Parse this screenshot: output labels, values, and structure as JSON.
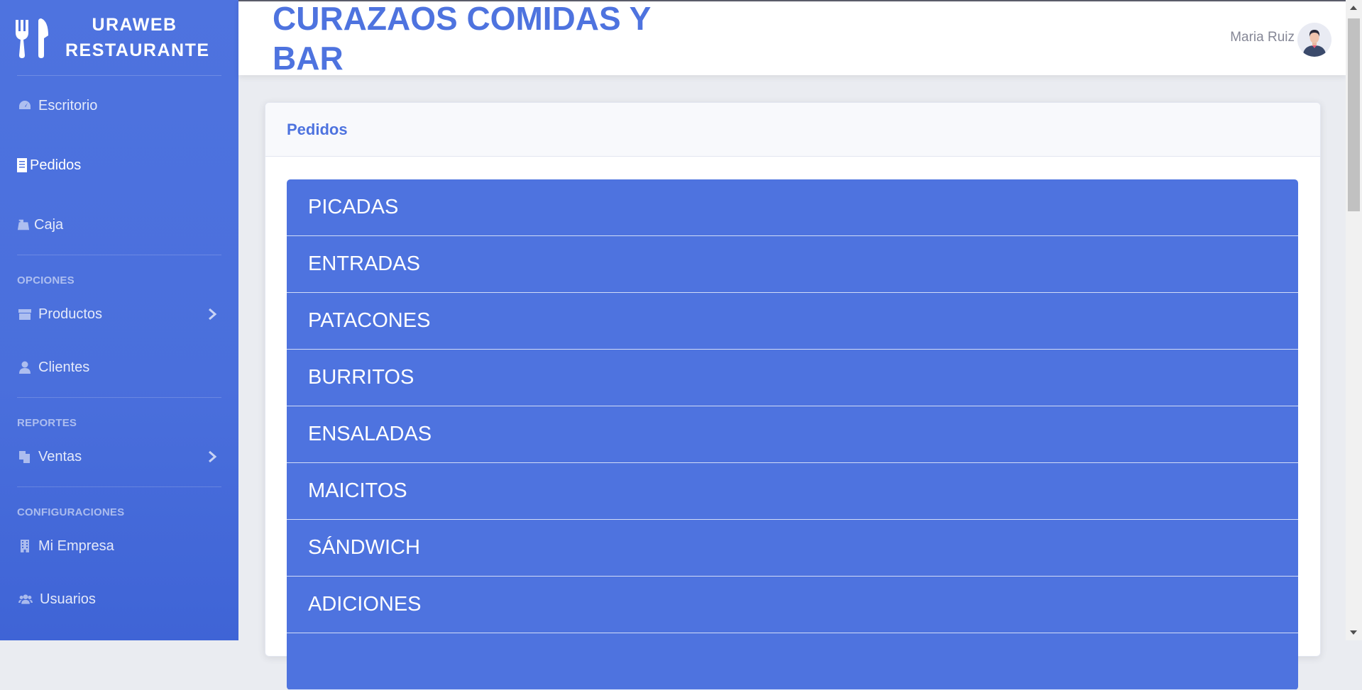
{
  "brand": {
    "line1": "URAWEB",
    "line2": "RESTAURANTE",
    "icon": "utensils-icon"
  },
  "sidebar": {
    "items": [
      {
        "label": "Escritorio",
        "icon": "dashboard-icon"
      },
      {
        "label": "Pedidos",
        "icon": "receipt-icon",
        "active": true
      },
      {
        "label": "Caja",
        "icon": "cash-register-icon"
      }
    ],
    "sections": [
      {
        "heading": "OPCIONES",
        "items": [
          {
            "label": "Productos",
            "icon": "box-icon",
            "has_submenu": true
          },
          {
            "label": "Clientes",
            "icon": "user-icon"
          }
        ]
      },
      {
        "heading": "REPORTES",
        "items": [
          {
            "label": "Ventas",
            "icon": "copy-icon",
            "has_submenu": true
          }
        ]
      },
      {
        "heading": "CONFIGURACIONES",
        "items": [
          {
            "label": "Mi Empresa",
            "icon": "building-icon"
          },
          {
            "label": "Usuarios",
            "icon": "users-icon"
          }
        ]
      }
    ]
  },
  "topbar": {
    "company_title": "CURAZAOS COMIDAS Y BAR",
    "user_name": "Maria Ruiz"
  },
  "card": {
    "title": "Pedidos",
    "categories": [
      "PICADAS",
      "ENTRADAS",
      "PATACONES",
      "BURRITOS",
      "ENSALADAS",
      "MAICITOS",
      "SÁNDWICH",
      "ADICIONES",
      ""
    ]
  },
  "colors": {
    "primary": "#4e73df",
    "sidebar": "#4e73df",
    "muted_text": "#858796"
  }
}
